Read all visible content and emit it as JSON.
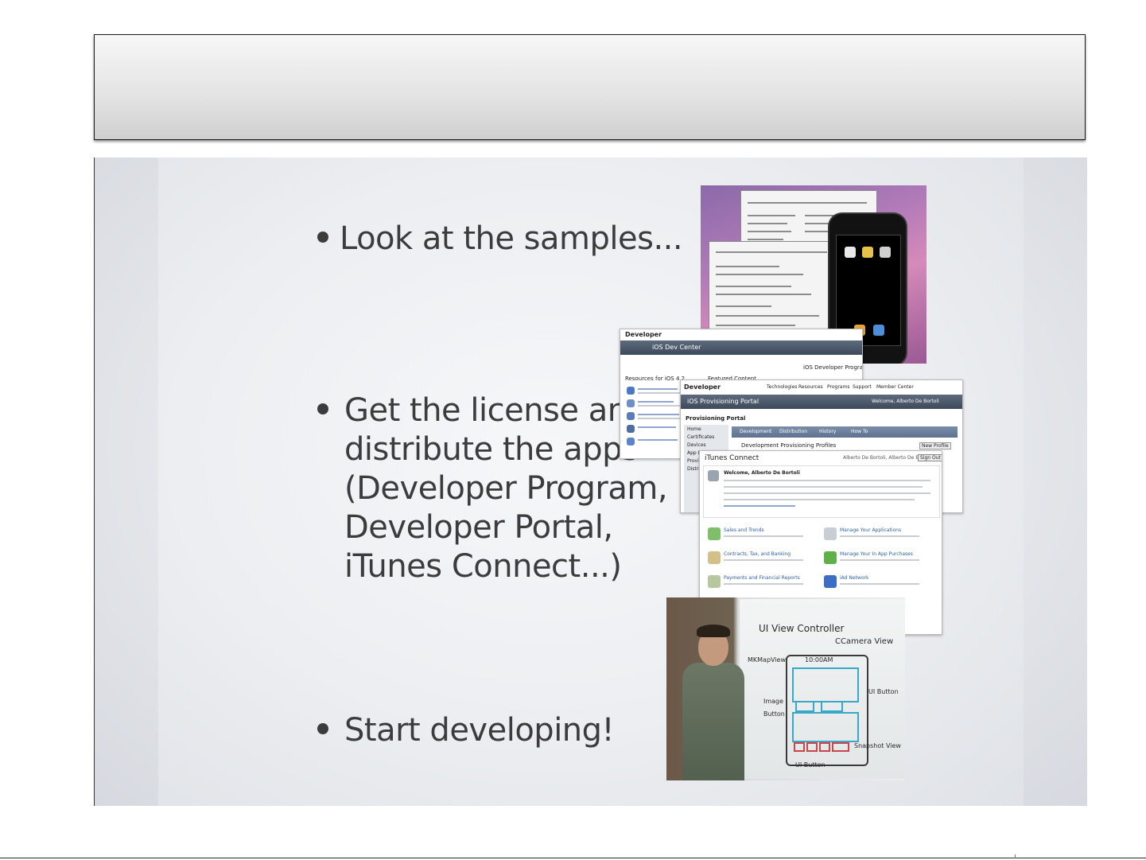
{
  "slide": {
    "bullets": [
      {
        "text": "Look at the samples..."
      },
      {
        "text": "Get the license and distribute the apps (Developer Program, Developer Portal, iTunes Connect...)"
      },
      {
        "text": "Start developing!"
      }
    ]
  },
  "screenshots": {
    "dev_center": {
      "brand": "Developer",
      "header": "iOS Dev Center",
      "section_label": "Featured Content",
      "program_label": "iOS Developer Program",
      "resources_label": "Resources for iOS 4.2"
    },
    "provisioning_portal": {
      "brand": "Developer",
      "nav": [
        "Technologies",
        "Resources",
        "Programs",
        "Support",
        "Member Center"
      ],
      "header": "iOS Provisioning Portal",
      "welcome": "Welcome, Alberto De Bortoli",
      "sidebar_title": "Provisioning Portal",
      "sidebar_items": [
        "Home",
        "Certificates",
        "Devices",
        "App IDs",
        "Provisioning",
        "Distribution"
      ],
      "tabs": [
        "Development",
        "Distribution",
        "History",
        "How To"
      ],
      "section": "Development Provisioning Profiles",
      "new_profile_button": "New Profile"
    },
    "itunes_connect": {
      "title": "iTunes Connect",
      "user": "Alberto De Bortoli, Alberto De Bortoli",
      "sign_out": "Sign Out",
      "welcome": "Welcome, Alberto De Bortoli",
      "modules": [
        {
          "title": "Sales and Trends",
          "icon": "sales-icon"
        },
        {
          "title": "Manage Your Applications",
          "icon": "apps-icon"
        },
        {
          "title": "Contracts, Tax, and Banking",
          "icon": "contracts-icon"
        },
        {
          "title": "Manage Your In App Purchases",
          "icon": "purchases-icon"
        },
        {
          "title": "Payments and Financial Reports",
          "icon": "payments-icon"
        },
        {
          "title": "iAd Network",
          "icon": "iad-icon"
        }
      ]
    },
    "whiteboard": {
      "labels": [
        "UI View Controller",
        "CCamera View",
        "MKMapView",
        "10:00AM",
        "UI Button",
        "Image",
        "Button",
        "Snapshot View",
        "UI Button"
      ]
    }
  },
  "colors": {
    "title_bar_border": "#1a1a1a",
    "slide_background": "#e9ebee",
    "bullet_text": "#3c3c3c"
  }
}
